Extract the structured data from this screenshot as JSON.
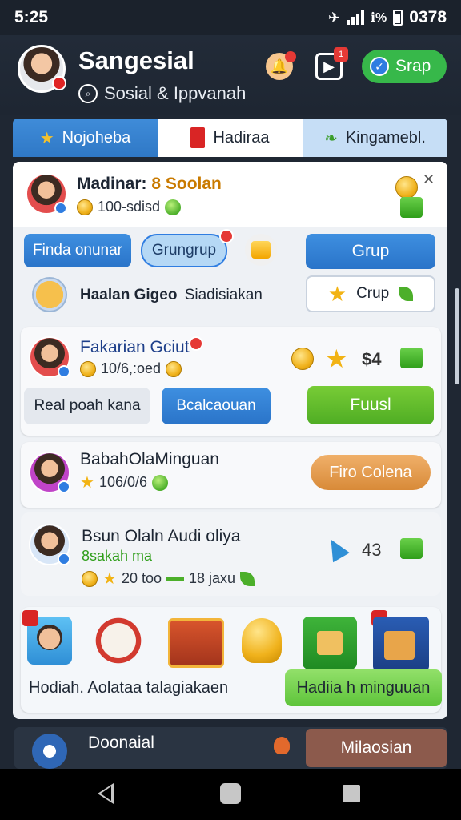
{
  "status_bar": {
    "time": "5:25",
    "battery_text": "0378",
    "signal_text": "ℹ%"
  },
  "header": {
    "title": "Sangesial",
    "subtitle": "Sosial & Ippvanah",
    "action_button": "Srap",
    "box_badge": "1"
  },
  "tabs": [
    {
      "label": "Nojoheba"
    },
    {
      "label": "Hadiraa"
    },
    {
      "label": "Kingamebl."
    }
  ],
  "top_card": {
    "name_prefix": "Madinar:",
    "name_highlight": "8 Soolan",
    "meta": "100-sdisd"
  },
  "action_row": {
    "button_1": "Finda onunar",
    "button_2": "Grungrup",
    "button_3": "Grup",
    "row2_label": "Haalan Gigeo",
    "row2_label2": "Siadisiakan",
    "row2_button": "Crup"
  },
  "card_1": {
    "name": "Fakarian Gciut",
    "meta": "10/6,:oed",
    "count": "$4",
    "chip_1": "Real poah kana",
    "chip_2": "Bcalcaouan",
    "chip_3": "Fuusl"
  },
  "card_2": {
    "name": "BabahOlaMinguan",
    "meta": "106/0/6",
    "button": "Firo Colena"
  },
  "card_3": {
    "name": "Bsun Olaln Audi oliya",
    "subname": "8sakah ma",
    "meta": "20 too",
    "meta_extra": "18 jaxu",
    "count": "43"
  },
  "rewards": {
    "label": "Hodiah. Aolataa talagiakaen",
    "button": "Hadiia h minguuan"
  },
  "bottom_card": {
    "title": "Doonaial",
    "button": "Milaosian"
  },
  "colors": {
    "accent_blue": "#2f7de1",
    "accent_green": "#4fad24",
    "accent_orange": "#d88a38",
    "background": "#1f2733"
  }
}
